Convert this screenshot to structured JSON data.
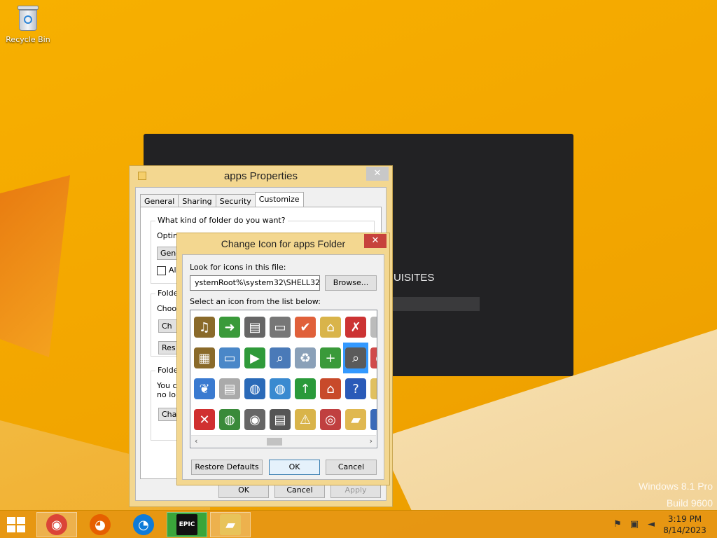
{
  "desktop": {
    "recycle_bin_label": "Recycle Bin",
    "installer_text": "UISITES",
    "watermark_line1": "Windows 8.1 Pro",
    "watermark_line2": "Build 9600"
  },
  "properties": {
    "title": "apps Properties",
    "close": "✕",
    "tabs": [
      "General",
      "Sharing",
      "Security",
      "Customize"
    ],
    "active_tab": "Customize",
    "q_kind": "What kind of folder do you want?",
    "optimise": "Optimise this folder for:",
    "optimise_value": "Gene",
    "also_apply": "Als",
    "folder_pictures_label": "Folder",
    "choose_text": "Choos",
    "choose_btn": "Ch",
    "restore_btn": "Res",
    "folder_icons_label": "Folder",
    "can_text": "You c",
    "nolonger_text": "no lon",
    "change_btn": "Cha",
    "ok": "OK",
    "cancel": "Cancel",
    "apply": "Apply"
  },
  "dialog": {
    "title": "Change Icon for apps Folder",
    "close": "✕",
    "look_label": "Look for icons in this file:",
    "path_value": "ystemRoot%\\system32\\SHELL32.dll",
    "browse": "Browse...",
    "select_label": "Select an icon from the list below:",
    "restore_defaults": "Restore Defaults",
    "ok": "OK",
    "cancel": "Cancel",
    "icons": [
      {
        "name": "music-folder-icon",
        "glyph": "♫",
        "color": "#8a6a2a"
      },
      {
        "name": "document-arrow-icon",
        "glyph": "➜",
        "color": "#3a9a3a"
      },
      {
        "name": "printer-icon",
        "glyph": "▤",
        "color": "#666666"
      },
      {
        "name": "projector-screen-icon",
        "glyph": "▭",
        "color": "#777777"
      },
      {
        "name": "checkmark-icon",
        "glyph": "✔",
        "color": "#e0603a"
      },
      {
        "name": "network-folder-icon",
        "glyph": "⌂",
        "color": "#d9b44a"
      },
      {
        "name": "task-list-icon",
        "glyph": "✗",
        "color": "#cc3333"
      },
      {
        "name": "partial-icon-1",
        "glyph": "▯",
        "color": "#bbbbbb"
      },
      {
        "name": "film-folder-icon",
        "glyph": "▦",
        "color": "#8a6a2a"
      },
      {
        "name": "device-icon",
        "glyph": "▭",
        "color": "#4a87c8"
      },
      {
        "name": "play-icon",
        "glyph": "▶",
        "color": "#2f9a3a"
      },
      {
        "name": "search-document-icon",
        "glyph": "⌕",
        "color": "#4a7ab8"
      },
      {
        "name": "recycle-bin-icon",
        "glyph": "♻",
        "color": "#8aa0b8"
      },
      {
        "name": "add-program-icon",
        "glyph": "+",
        "color": "#3a9a3a"
      },
      {
        "name": "magnifier-icon",
        "glyph": "⌕",
        "color": "#5a5a5a"
      },
      {
        "name": "partial-icon-2",
        "glyph": "●",
        "color": "#d04a4a"
      },
      {
        "name": "butterfly-icon",
        "glyph": "❦",
        "color": "#3a7ad0"
      },
      {
        "name": "documents-icon",
        "glyph": "▤",
        "color": "#aaaaaa"
      },
      {
        "name": "globe-icon",
        "glyph": "◍",
        "color": "#2a6ab8"
      },
      {
        "name": "picture-globe-icon",
        "glyph": "◍",
        "color": "#3a8ad0"
      },
      {
        "name": "green-up-arrow-icon",
        "glyph": "↑",
        "color": "#2a9a3a"
      },
      {
        "name": "home-icon",
        "glyph": "⌂",
        "color": "#c84a2a"
      },
      {
        "name": "help-icon",
        "glyph": "?",
        "color": "#2a5ab8"
      },
      {
        "name": "partial-icon-3",
        "glyph": "▯",
        "color": "#e0c060"
      },
      {
        "name": "red-x-icon",
        "glyph": "✕",
        "color": "#d03030"
      },
      {
        "name": "globe-arrow-icon",
        "glyph": "◍",
        "color": "#3a8a3a"
      },
      {
        "name": "camera-icon",
        "glyph": "◉",
        "color": "#666666"
      },
      {
        "name": "scanner-icon",
        "glyph": "▤",
        "color": "#555555"
      },
      {
        "name": "folder-warning-icon",
        "glyph": "⚠",
        "color": "#d9b44a"
      },
      {
        "name": "disc-icon",
        "glyph": "◎",
        "color": "#c04040"
      },
      {
        "name": "folder-icon",
        "glyph": "▰",
        "color": "#e0b850"
      },
      {
        "name": "partial-icon-4",
        "glyph": "▯",
        "color": "#3a6ab8"
      }
    ],
    "selected_icon_index": 14
  },
  "taskbar": {
    "apps": [
      {
        "name": "chrome-taskbar-icon",
        "glyph": "◉",
        "color": "#db4437"
      },
      {
        "name": "firefox-taskbar-icon",
        "glyph": "◕",
        "color": "#e66000"
      },
      {
        "name": "edge-taskbar-icon",
        "glyph": "◔",
        "color": "#0f7bd8"
      },
      {
        "name": "epic-games-taskbar-icon",
        "glyph": "EPIC",
        "color": "#111111"
      },
      {
        "name": "file-explorer-taskbar-icon",
        "glyph": "▰",
        "color": "#e8c35a"
      }
    ],
    "time": "3:19 PM",
    "date": "8/14/2023"
  }
}
